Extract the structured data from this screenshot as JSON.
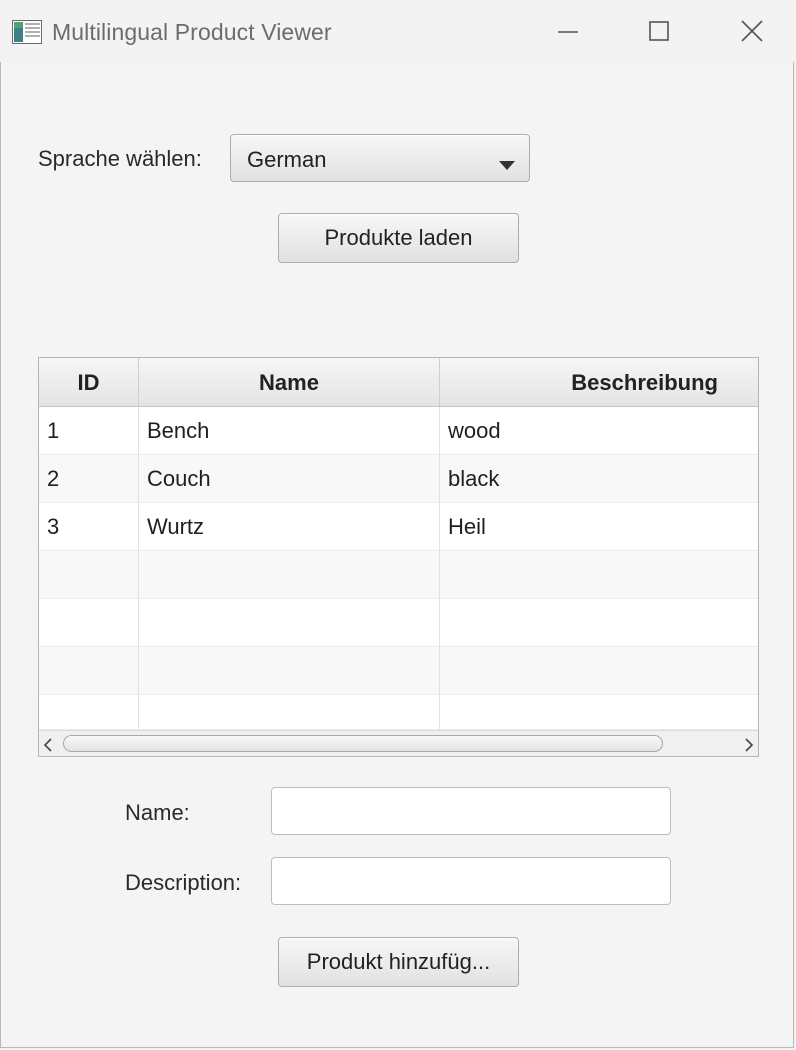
{
  "window": {
    "title": "Multilingual Product Viewer",
    "icon": "app-window-icon",
    "controls": [
      "minimize-icon",
      "maximize-icon",
      "close-icon"
    ]
  },
  "language": {
    "label": "Sprache wählen:",
    "selected": "German"
  },
  "load_button": "Produkte laden",
  "table": {
    "columns": [
      "ID",
      "Name",
      "Beschreibung"
    ],
    "rows": [
      {
        "id": "1",
        "name": "Bench",
        "description": "wood"
      },
      {
        "id": "2",
        "name": "Couch",
        "description": "black"
      },
      {
        "id": "3",
        "name": "Wurtz",
        "description": "Heil"
      }
    ],
    "empty_rows": 4
  },
  "form": {
    "name_label": "Name:",
    "name_value": "",
    "description_label": "Description:",
    "description_value": ""
  },
  "add_button": "Produkt hinzufüg..."
}
